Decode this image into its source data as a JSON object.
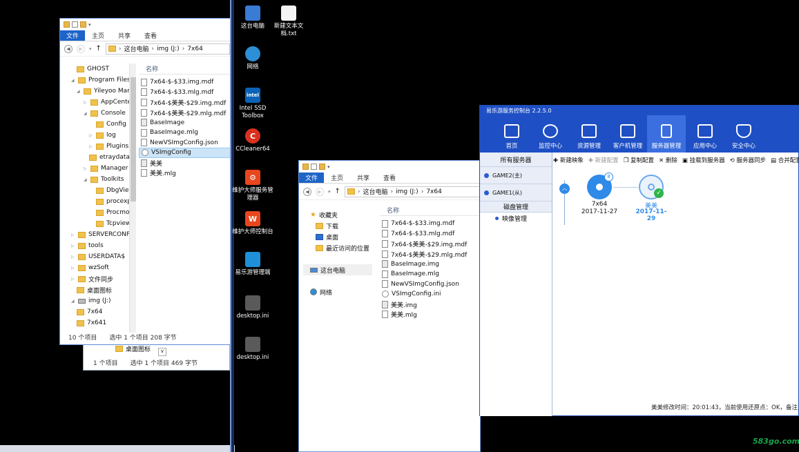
{
  "explorer_back": {
    "ribbon": {
      "file": "文件",
      "home": "主页",
      "share": "共享",
      "view": "查看"
    },
    "address": [
      "这台电脑",
      "img (J:)",
      "7x64"
    ],
    "tree": [
      "GHOST",
      "Program Files",
      "Yileyoo Mar",
      "AppCenter",
      "Console",
      "Config",
      "log",
      "Plugins",
      "etraydata",
      "Manager",
      "Toolkits",
      "DbgView",
      "procexp",
      "Procmor",
      "Tcpview",
      "SERVERCONF",
      "tools",
      "USERDATA$",
      "wzSoft",
      "文件同步",
      "桌面图标",
      "img (J:)",
      "7x64",
      "7x641"
    ],
    "column_name": "名称",
    "files": [
      "7x64-$-$33.img.mdf",
      "7x64-$-$33.mlg.mdf",
      "7x64-$美美-$29.img.mdf",
      "7x64-$美美-$29.mlg.mdf",
      "BaseImage",
      "BaseImage.mlg",
      "NewVSImgConfig.json",
      "VSImgConfig",
      "美美",
      "美美.mlg"
    ],
    "status_count": "10 个项目",
    "status_selected": "选中 1 个项目  208 字节",
    "behind_item": "桌面图标",
    "behind_status_count": "1 个项目",
    "behind_status_selected": "选中 1 个项目  469 字节"
  },
  "desktop": {
    "icons": [
      "这台电脑",
      "新建文本文档.txt",
      "网络",
      "Intel SSD Toolbox",
      "CCleaner64",
      "维护大师服务管理器",
      "维护大师控制台",
      "易乐游管理端",
      "desktop.ini",
      "desktop.ini"
    ]
  },
  "explorer_front": {
    "ribbon": {
      "file": "文件",
      "home": "主页",
      "share": "共享",
      "view": "查看"
    },
    "address": [
      "这台电脑",
      "img (J:)",
      "7x64"
    ],
    "nav": {
      "favorites": "收藏夹",
      "downloads": "下载",
      "desktop": "桌面",
      "recent": "最近访问的位置",
      "thispc": "这台电脑",
      "network": "网络"
    },
    "column_name": "名称",
    "files": [
      "7x64-$-$33.img.mdf",
      "7x64-$-$33.mlg.mdf",
      "7x64-$美美-$29.img.mdf",
      "7x64-$美美-$29.mlg.mdf",
      "BaseImage.img",
      "BaseImage.mlg",
      "NewVSImgConfig.json",
      "VSImgConfig.ini",
      "美美.img",
      "美美.mlg"
    ]
  },
  "control_panel": {
    "title": "易乐游服务控制台 2.2.5.0",
    "toolbar": [
      "首页",
      "监控中心",
      "资源管理",
      "客户机管理",
      "服务器管理",
      "应用中心",
      "安全中心"
    ],
    "left": {
      "all_servers": "所有服务器",
      "game2": "GAME2(主)",
      "game1": "GAME1(从)",
      "disk_mgmt": "磁盘管理",
      "image_mgmt": "映像管理"
    },
    "actions": [
      "新建映象",
      "新建配置",
      "复制配置",
      "删除",
      "挂载到服务器",
      "服务器同步",
      "合并配置"
    ],
    "nodes": [
      {
        "name": "7x64",
        "date": "2017-11-27",
        "badge": "8"
      },
      {
        "name": "美美",
        "date": "2017-11-29"
      }
    ],
    "status": "美美修改时间：20:01:43，当前使用还原点：OK，备注："
  },
  "watermark": "583go.com"
}
